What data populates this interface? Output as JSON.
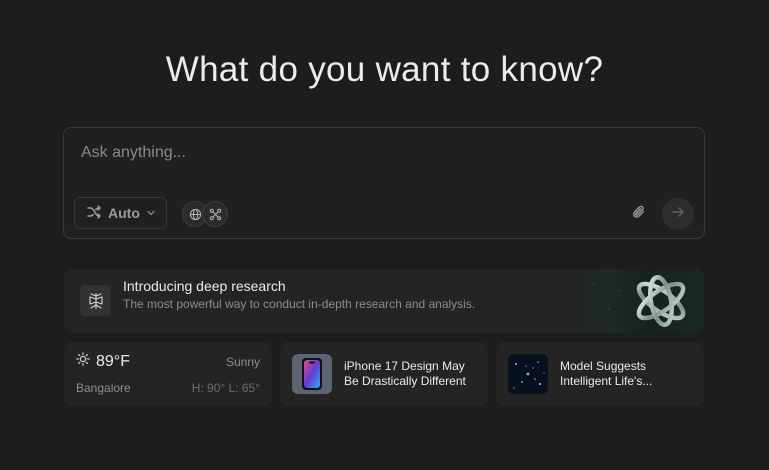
{
  "heading": "What do you want to know?",
  "search": {
    "placeholder": "Ask anything...",
    "value": "",
    "mode_label": "Auto",
    "sources": [
      {
        "icon": "globe-icon"
      },
      {
        "icon": "connections-icon"
      }
    ]
  },
  "research": {
    "title": "Introducing deep research",
    "description": "The most powerful way to conduct in-depth research and analysis."
  },
  "weather": {
    "temperature": "89°F",
    "condition": "Sunny",
    "city": "Bangalore",
    "range": "H: 90° L: 65°"
  },
  "news": [
    {
      "title": "iPhone 17 Design May Be Drastically Different",
      "thumb": "phone-image"
    },
    {
      "title": "Model Suggests Intelligent Life's...",
      "thumb": "galaxy-image"
    }
  ],
  "colors": {
    "background": "#1c1d1c",
    "card": "#232423",
    "accent_research": "#1a2a22"
  }
}
